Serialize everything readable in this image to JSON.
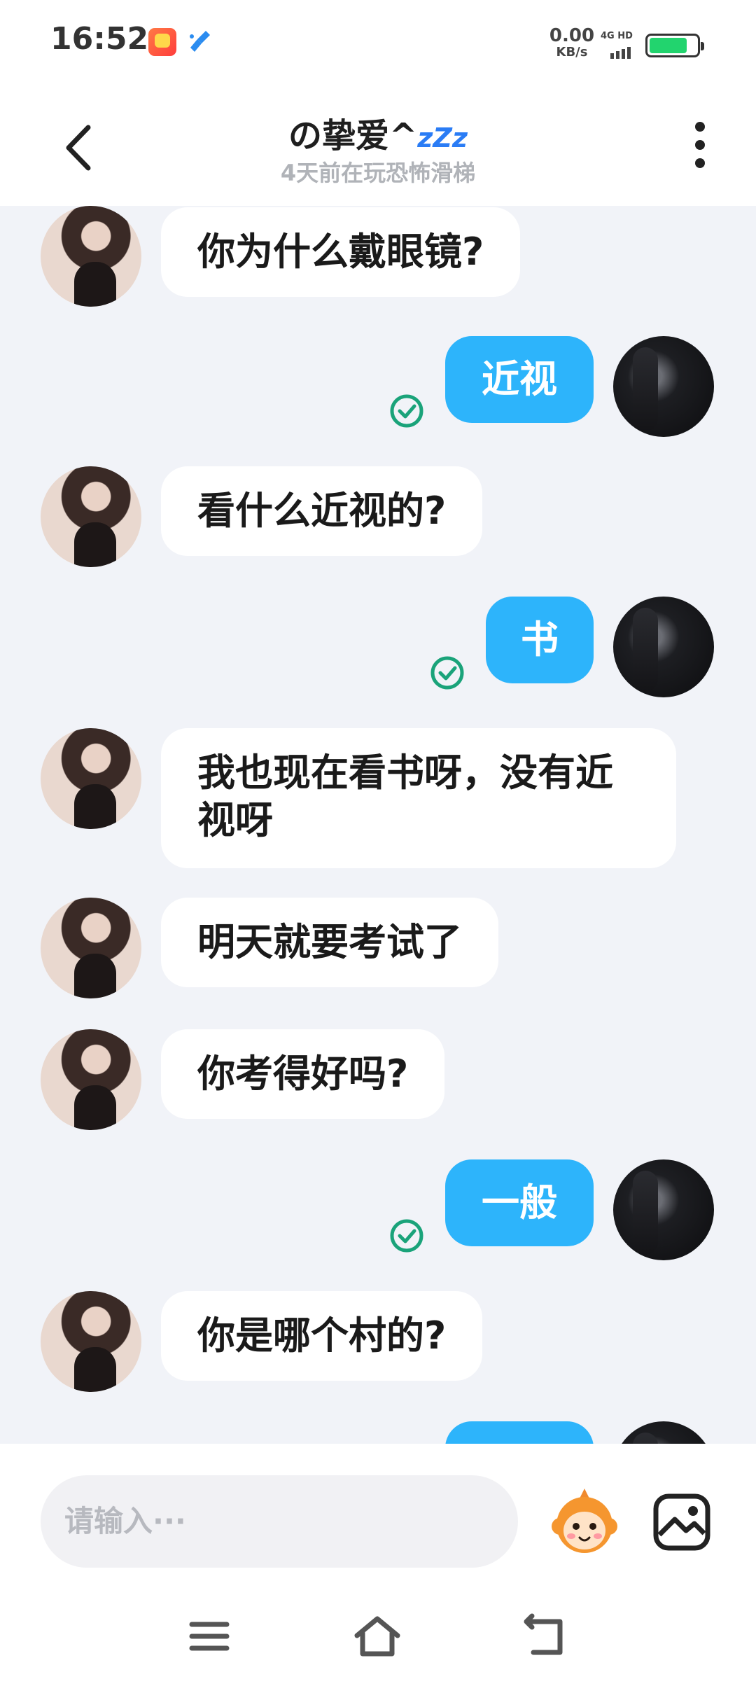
{
  "status_bar": {
    "time": "16:52",
    "net_speed_value": "0.00",
    "net_speed_unit": "KB/s",
    "network_type": "4G HD",
    "battery_level": 0.8,
    "battery_color": "#22d46e"
  },
  "header": {
    "title": "の挚爱^",
    "title_suffix": "zZz",
    "subtitle": "4天前在玩恐怖滑梯",
    "back_icon": "chevron-left-icon",
    "more_icon": "more-vertical-icon"
  },
  "messages": [
    {
      "from": "them",
      "text": "你为什么戴眼镜?"
    },
    {
      "from": "me",
      "text": "近视",
      "read": true
    },
    {
      "from": "them",
      "text": "看什么近视的?"
    },
    {
      "from": "me",
      "text": "书",
      "read": true
    },
    {
      "from": "them",
      "text": "我也现在看书呀，没有近视呀"
    },
    {
      "from": "them",
      "text": "明天就要考试了"
    },
    {
      "from": "them",
      "text": "你考得好吗?"
    },
    {
      "from": "me",
      "text": "一般",
      "read": true
    },
    {
      "from": "them",
      "text": "你是哪个村的?"
    }
  ],
  "input": {
    "placeholder": "请输入···"
  },
  "colors": {
    "outgoing_bubble": "#2db4fb",
    "incoming_bubble": "#ffffff",
    "read_check": "#1aa37a",
    "chat_background": "#f1f3f8"
  },
  "nav": {
    "menu_icon": "menu-icon",
    "home_icon": "home-icon",
    "back_icon": "back-arrow-icon"
  }
}
